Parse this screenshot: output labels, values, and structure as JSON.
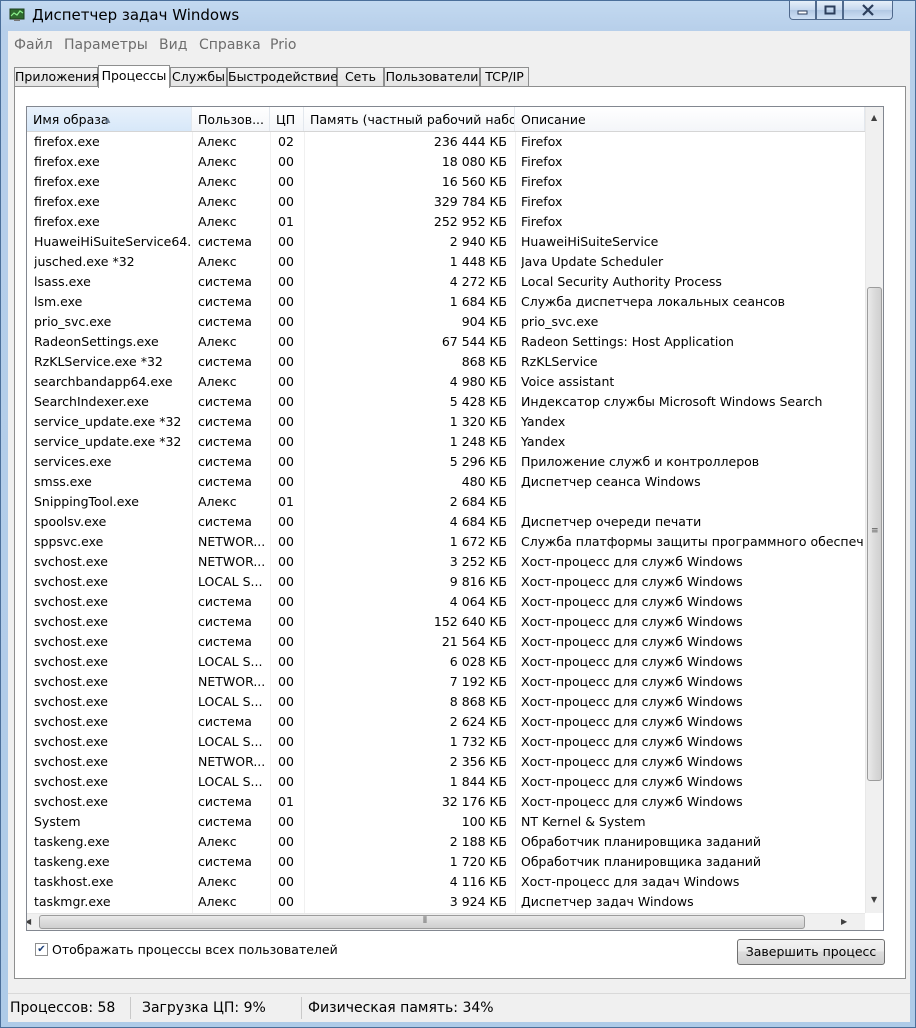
{
  "window": {
    "title": "Диспетчер задач Windows",
    "icon": "task-manager-icon"
  },
  "menu": [
    "Файл",
    "Параметры",
    "Вид",
    "Справка",
    "Prio"
  ],
  "tabs": [
    {
      "label": "Приложения",
      "active": false
    },
    {
      "label": "Процессы",
      "active": true
    },
    {
      "label": "Службы",
      "active": false
    },
    {
      "label": "Быстродействие",
      "active": false
    },
    {
      "label": "Сеть",
      "active": false
    },
    {
      "label": "Пользователи",
      "active": false
    },
    {
      "label": "TCP/IP",
      "active": false
    }
  ],
  "columns": {
    "name": "Имя образа",
    "user": "Пользов...",
    "cpu": "ЦП",
    "memory": "Память (частный рабочий набор)",
    "description": "Описание"
  },
  "rows": [
    {
      "name": "firefox.exe",
      "user": "Алекс",
      "cpu": "02",
      "memory": "236 444 КБ",
      "description": "Firefox"
    },
    {
      "name": "firefox.exe",
      "user": "Алекс",
      "cpu": "00",
      "memory": "18 080 КБ",
      "description": "Firefox"
    },
    {
      "name": "firefox.exe",
      "user": "Алекс",
      "cpu": "00",
      "memory": "16 560 КБ",
      "description": "Firefox"
    },
    {
      "name": "firefox.exe",
      "user": "Алекс",
      "cpu": "00",
      "memory": "329 784 КБ",
      "description": "Firefox"
    },
    {
      "name": "firefox.exe",
      "user": "Алекс",
      "cpu": "01",
      "memory": "252 952 КБ",
      "description": "Firefox"
    },
    {
      "name": "HuaweiHiSuiteService64....",
      "user": "система",
      "cpu": "00",
      "memory": "2 940 КБ",
      "description": "HuaweiHiSuiteService"
    },
    {
      "name": "jusched.exe *32",
      "user": "Алекс",
      "cpu": "00",
      "memory": "1 448 КБ",
      "description": "Java Update Scheduler"
    },
    {
      "name": "lsass.exe",
      "user": "система",
      "cpu": "00",
      "memory": "4 272 КБ",
      "description": "Local Security Authority Process"
    },
    {
      "name": "lsm.exe",
      "user": "система",
      "cpu": "00",
      "memory": "1 684 КБ",
      "description": "Служба диспетчера локальных сеансов"
    },
    {
      "name": "prio_svc.exe",
      "user": "система",
      "cpu": "00",
      "memory": "904 КБ",
      "description": "prio_svc.exe"
    },
    {
      "name": "RadeonSettings.exe",
      "user": "Алекс",
      "cpu": "00",
      "memory": "67 544 КБ",
      "description": "Radeon Settings: Host Application"
    },
    {
      "name": "RzKLService.exe *32",
      "user": "система",
      "cpu": "00",
      "memory": "868 КБ",
      "description": "RzKLService"
    },
    {
      "name": "searchbandapp64.exe",
      "user": "Алекс",
      "cpu": "00",
      "memory": "4 980 КБ",
      "description": "Voice assistant"
    },
    {
      "name": "SearchIndexer.exe",
      "user": "система",
      "cpu": "00",
      "memory": "5 428 КБ",
      "description": "Индексатор службы Microsoft Windows Search"
    },
    {
      "name": "service_update.exe *32",
      "user": "система",
      "cpu": "00",
      "memory": "1 320 КБ",
      "description": "Yandex"
    },
    {
      "name": "service_update.exe *32",
      "user": "система",
      "cpu": "00",
      "memory": "1 248 КБ",
      "description": "Yandex"
    },
    {
      "name": "services.exe",
      "user": "система",
      "cpu": "00",
      "memory": "5 296 КБ",
      "description": "Приложение служб и контроллеров"
    },
    {
      "name": "smss.exe",
      "user": "система",
      "cpu": "00",
      "memory": "480 КБ",
      "description": "Диспетчер сеанса  Windows"
    },
    {
      "name": "SnippingTool.exe",
      "user": "Алекс",
      "cpu": "01",
      "memory": "2 684 КБ",
      "description": ""
    },
    {
      "name": "spoolsv.exe",
      "user": "система",
      "cpu": "00",
      "memory": "4 684 КБ",
      "description": "Диспетчер очереди печати"
    },
    {
      "name": "sppsvc.exe",
      "user": "NETWOR...",
      "cpu": "00",
      "memory": "1 672 КБ",
      "description": "Служба платформы защиты программного обеспечения"
    },
    {
      "name": "svchost.exe",
      "user": "NETWOR...",
      "cpu": "00",
      "memory": "3 252 КБ",
      "description": "Хост-процесс для служб Windows"
    },
    {
      "name": "svchost.exe",
      "user": "LOCAL S...",
      "cpu": "00",
      "memory": "9 816 КБ",
      "description": "Хост-процесс для служб Windows"
    },
    {
      "name": "svchost.exe",
      "user": "система",
      "cpu": "00",
      "memory": "4 064 КБ",
      "description": "Хост-процесс для служб Windows"
    },
    {
      "name": "svchost.exe",
      "user": "система",
      "cpu": "00",
      "memory": "152 640 КБ",
      "description": "Хост-процесс для служб Windows"
    },
    {
      "name": "svchost.exe",
      "user": "система",
      "cpu": "00",
      "memory": "21 564 КБ",
      "description": "Хост-процесс для служб Windows"
    },
    {
      "name": "svchost.exe",
      "user": "LOCAL S...",
      "cpu": "00",
      "memory": "6 028 КБ",
      "description": "Хост-процесс для служб Windows"
    },
    {
      "name": "svchost.exe",
      "user": "NETWOR...",
      "cpu": "00",
      "memory": "7 192 КБ",
      "description": "Хост-процесс для служб Windows"
    },
    {
      "name": "svchost.exe",
      "user": "LOCAL S...",
      "cpu": "00",
      "memory": "8 868 КБ",
      "description": "Хост-процесс для служб Windows"
    },
    {
      "name": "svchost.exe",
      "user": "система",
      "cpu": "00",
      "memory": "2 624 КБ",
      "description": "Хост-процесс для служб Windows"
    },
    {
      "name": "svchost.exe",
      "user": "LOCAL S...",
      "cpu": "00",
      "memory": "1 732 КБ",
      "description": "Хост-процесс для служб Windows"
    },
    {
      "name": "svchost.exe",
      "user": "NETWOR...",
      "cpu": "00",
      "memory": "2 356 КБ",
      "description": "Хост-процесс для служб Windows"
    },
    {
      "name": "svchost.exe",
      "user": "LOCAL S...",
      "cpu": "00",
      "memory": "1 844 КБ",
      "description": "Хост-процесс для служб Windows"
    },
    {
      "name": "svchost.exe",
      "user": "система",
      "cpu": "01",
      "memory": "32 176 КБ",
      "description": "Хост-процесс для служб Windows"
    },
    {
      "name": "System",
      "user": "система",
      "cpu": "00",
      "memory": "100 КБ",
      "description": "NT Kernel & System"
    },
    {
      "name": "taskeng.exe",
      "user": "Алекс",
      "cpu": "00",
      "memory": "2 188 КБ",
      "description": "Обработчик планировщика заданий"
    },
    {
      "name": "taskeng.exe",
      "user": "система",
      "cpu": "00",
      "memory": "1 720 КБ",
      "description": "Обработчик планировщика заданий"
    },
    {
      "name": "taskhost.exe",
      "user": "Алекс",
      "cpu": "00",
      "memory": "4 116 КБ",
      "description": "Хост-процесс для задач Windows"
    },
    {
      "name": "taskmgr.exe",
      "user": "Алекс",
      "cpu": "00",
      "memory": "3 924 КБ",
      "description": "Диспетчер задач Windows"
    }
  ],
  "show_all_users": {
    "label": "Отображать процессы всех пользователей",
    "checked": true
  },
  "end_process_label": "Завершить процесс",
  "status": {
    "processes": "Процессов: 58",
    "cpu": "Загрузка ЦП: 9%",
    "memory": "Физическая память: 34%"
  }
}
